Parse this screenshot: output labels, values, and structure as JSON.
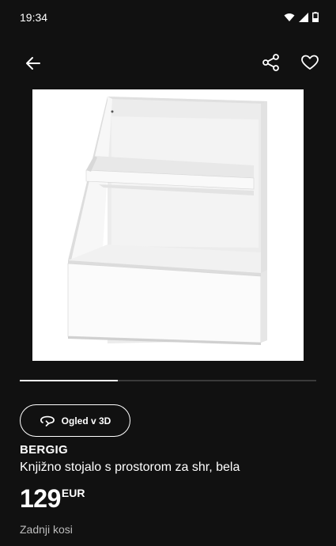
{
  "status_bar": {
    "time": "19:34",
    "icons": [
      "wifi-icon",
      "signal-icon",
      "battery-icon"
    ]
  },
  "app_bar": {
    "back_icon": "arrow-left-icon",
    "share_icon": "share-icon",
    "favorite_icon": "heart-icon"
  },
  "product": {
    "image_alt": "bookcase",
    "name": "BERGIG",
    "description": "Knjižno stojalo s prostorom za shr, bela",
    "price": "129",
    "currency": "EUR",
    "sub_label": "Zadnji kosi"
  },
  "carousel": {
    "progress": 0.33
  },
  "view_3d": {
    "label": "Ogled v 3D",
    "icon": "rotate-3d-icon"
  },
  "colors": {
    "background": "#111111",
    "text": "#ffffff",
    "muted": "#bdbdbd"
  }
}
